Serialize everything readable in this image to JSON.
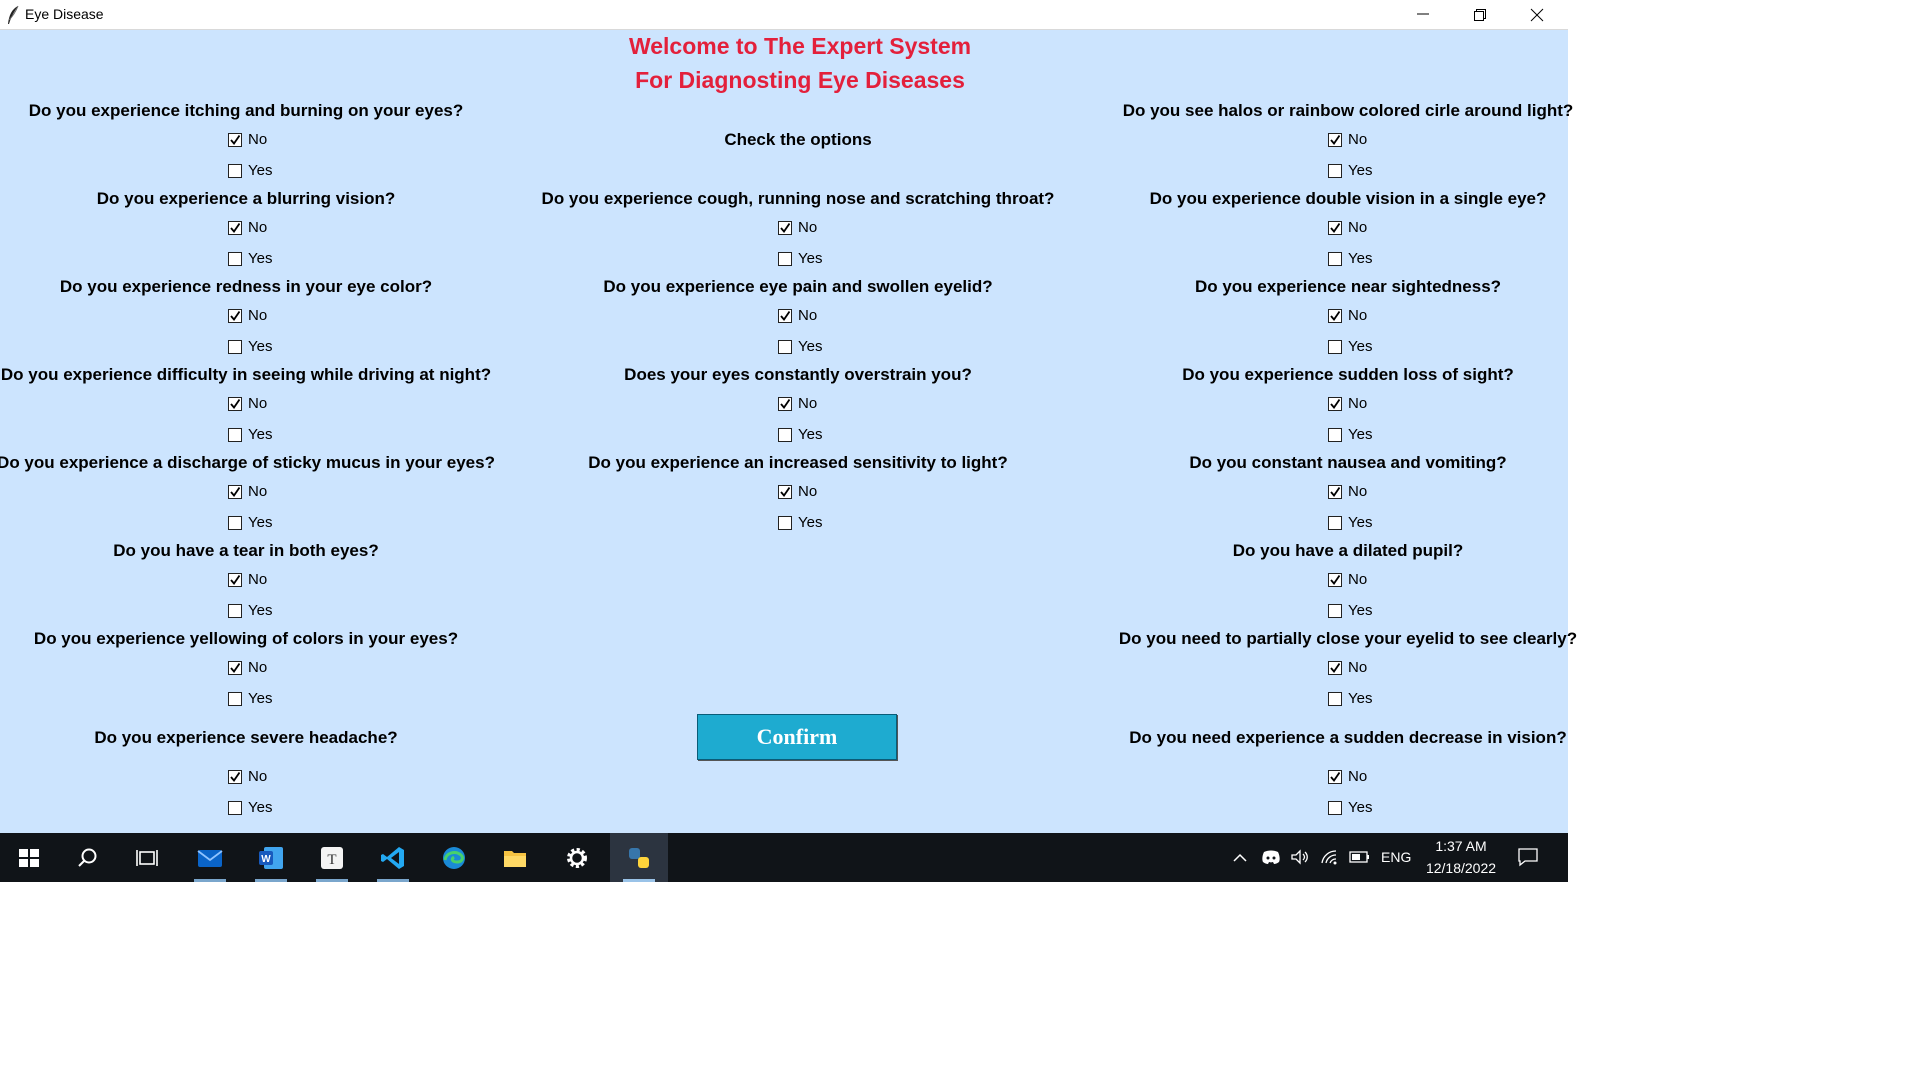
{
  "window": {
    "title": "Eye Disease"
  },
  "header": {
    "line1": "Welcome to The Expert System",
    "line2": "For Diagnosting Eye Diseases",
    "color": "#e3203b"
  },
  "center_label": "Check the options",
  "questions": {
    "left": [
      {
        "text": "Do you experience itching and burning on your eyes?",
        "no": "No",
        "yes": "Yes"
      },
      {
        "text": "Do you experience a blurring vision?",
        "no": "No",
        "yes": "Yes"
      },
      {
        "text": "Do you experience redness in your eye color?",
        "no": "No",
        "yes": "Yes"
      },
      {
        "text": "Do you experience difficulty in seeing while driving at night?",
        "no": "No",
        "yes": "Yes"
      },
      {
        "text": "Do you experience a discharge of sticky mucus in your eyes?",
        "no": "No",
        "yes": "Yes"
      },
      {
        "text": "Do you have a tear in both eyes?",
        "no": "No",
        "yes": "Yes"
      },
      {
        "text": "Do you experience yellowing of colors in your eyes?",
        "no": "No",
        "yes": "Yes"
      },
      {
        "text": "Do you experience severe headache?",
        "no": "No",
        "yes": "Yes"
      }
    ],
    "middle": [
      {
        "text": "Do you experience cough, running nose and scratching throat?",
        "no": "No",
        "yes": "Yes"
      },
      {
        "text": "Do you experience eye pain and swollen eyelid?",
        "no": "No",
        "yes": "Yes"
      },
      {
        "text": "Does your eyes constantly overstrain you?",
        "no": "No",
        "yes": "Yes"
      },
      {
        "text": "Do you experience an increased sensitivity to light?",
        "no": "No",
        "yes": "Yes"
      }
    ],
    "right": [
      {
        "text": "Do you see halos or rainbow colored cirle around light?",
        "no": "No",
        "yes": "Yes"
      },
      {
        "text": "Do you experience double vision in a single eye?",
        "no": "No",
        "yes": "Yes"
      },
      {
        "text": "Do you experience near sightedness?",
        "no": "No",
        "yes": "Yes"
      },
      {
        "text": "Do you experience sudden loss of sight?",
        "no": "No",
        "yes": "Yes"
      },
      {
        "text": "Do you constant nausea and vomiting?",
        "no": "No",
        "yes": "Yes"
      },
      {
        "text": "Do you have a dilated pupil?",
        "no": "No",
        "yes": "Yes"
      },
      {
        "text": "Do you need to partially close your eyelid to see clearly?",
        "no": "No",
        "yes": "Yes"
      },
      {
        "text": "Do you need experience a sudden decrease in vision?",
        "no": "No",
        "yes": "Yes"
      }
    ]
  },
  "confirm_label": "Confirm",
  "taskbar": {
    "apps": [
      "start-icon",
      "search-icon",
      "task-view-icon",
      "mail-icon",
      "word-icon",
      "typora-icon",
      "vscode-icon",
      "edge-icon",
      "file-explorer-icon",
      "settings-icon",
      "python-icon"
    ],
    "active_app": "python-icon",
    "language": "ENG",
    "time": "1:37 AM",
    "date": "12/18/2022"
  },
  "colors": {
    "background": "#cce4fe",
    "confirm": "#1eabd0",
    "taskbar": "#101418"
  }
}
